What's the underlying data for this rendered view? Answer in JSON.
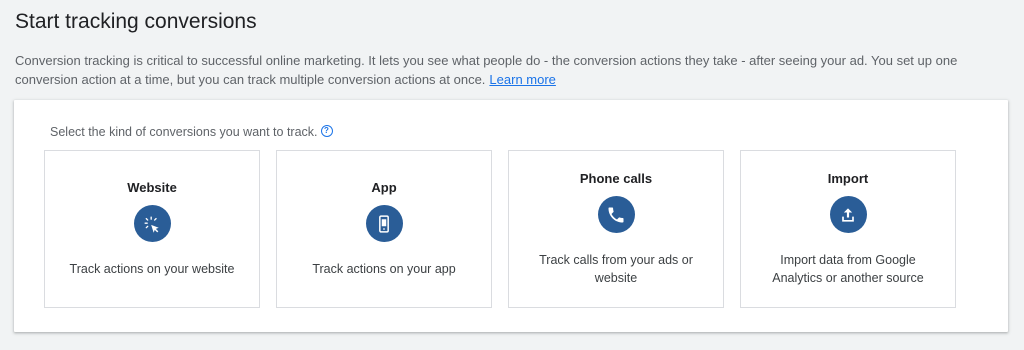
{
  "header": {
    "title": "Start tracking conversions"
  },
  "intro": {
    "text": "Conversion tracking is critical to successful online marketing. It lets you see what people do - the conversion actions they take - after seeing your ad. You set up one conversion action at a time, but you can track multiple conversion actions at once.",
    "link_label": "Learn more"
  },
  "panel": {
    "prompt": "Select the kind of conversions you want to track.",
    "help_icon": "question-mark-circle-icon",
    "cards": [
      {
        "title": "Website",
        "icon": "cursor-click-icon",
        "description": "Track actions on your website"
      },
      {
        "title": "App",
        "icon": "mobile-phone-icon",
        "description": "Track actions on your app"
      },
      {
        "title": "Phone calls",
        "icon": "phone-handset-icon",
        "description": "Track calls from your ads or website"
      },
      {
        "title": "Import",
        "icon": "upload-icon",
        "description": "Import data from Google Analytics or another source"
      }
    ]
  },
  "colors": {
    "accent": "#1a73e8",
    "icon_bg": "#2a5d97",
    "page_bg": "#f1f3f4"
  }
}
